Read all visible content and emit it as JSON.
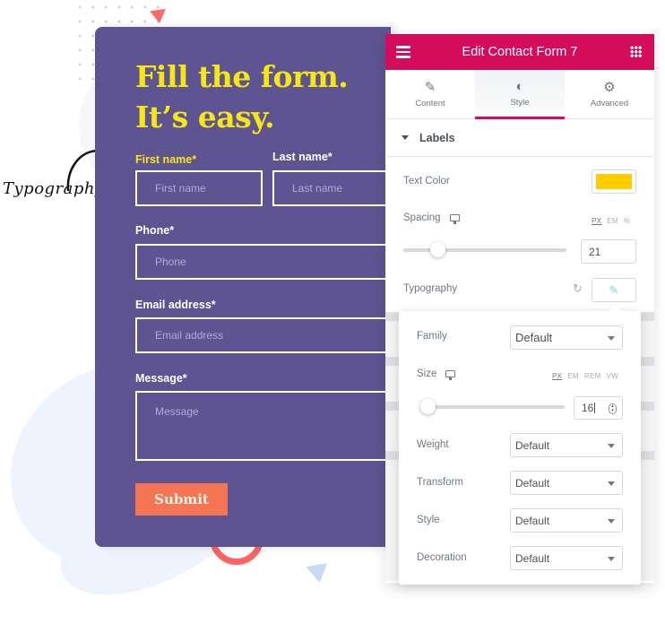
{
  "annotation": {
    "text": "Typography"
  },
  "form": {
    "headline_line1": "Fill the form.",
    "headline_line2": "It’s easy.",
    "fields": {
      "first_name": {
        "label": "First name*",
        "placeholder": "First name"
      },
      "last_name": {
        "label": "Last name*",
        "placeholder": "Last name"
      },
      "phone": {
        "label": "Phone*",
        "placeholder": "Phone"
      },
      "email": {
        "label": "Email address*",
        "placeholder": "Email address"
      },
      "message": {
        "label": "Message*",
        "placeholder": "Message"
      }
    },
    "submit_label": "Submit",
    "colors": {
      "background": "#5d5491",
      "headline": "#f6e616",
      "button": "#f47553"
    }
  },
  "panel": {
    "title": "Edit Contact Form 7",
    "header_color": "#d30c5c",
    "tabs": [
      {
        "label": "Content",
        "icon": "pencil-icon"
      },
      {
        "label": "Style",
        "icon": "contrast-icon",
        "active": true
      },
      {
        "label": "Advanced",
        "icon": "gear-icon"
      }
    ],
    "section_title": "Labels",
    "text_color": {
      "label": "Text Color",
      "value": "#ffcc00"
    },
    "spacing": {
      "label": "Spacing",
      "units": [
        "PX",
        "EM",
        "%"
      ],
      "selected_unit": "PX",
      "value": "21"
    },
    "typography": {
      "label": "Typography"
    }
  },
  "typography_popover": {
    "family": {
      "label": "Family",
      "value": "Default"
    },
    "size": {
      "label": "Size",
      "units": [
        "PX",
        "EM",
        "REM",
        "VW"
      ],
      "selected_unit": "PX",
      "value": "16"
    },
    "weight": {
      "label": "Weight",
      "value": "Default"
    },
    "transform": {
      "label": "Transform",
      "value": "Default"
    },
    "style": {
      "label": "Style",
      "value": "Default"
    },
    "decoration": {
      "label": "Decoration",
      "value": "Default"
    }
  }
}
